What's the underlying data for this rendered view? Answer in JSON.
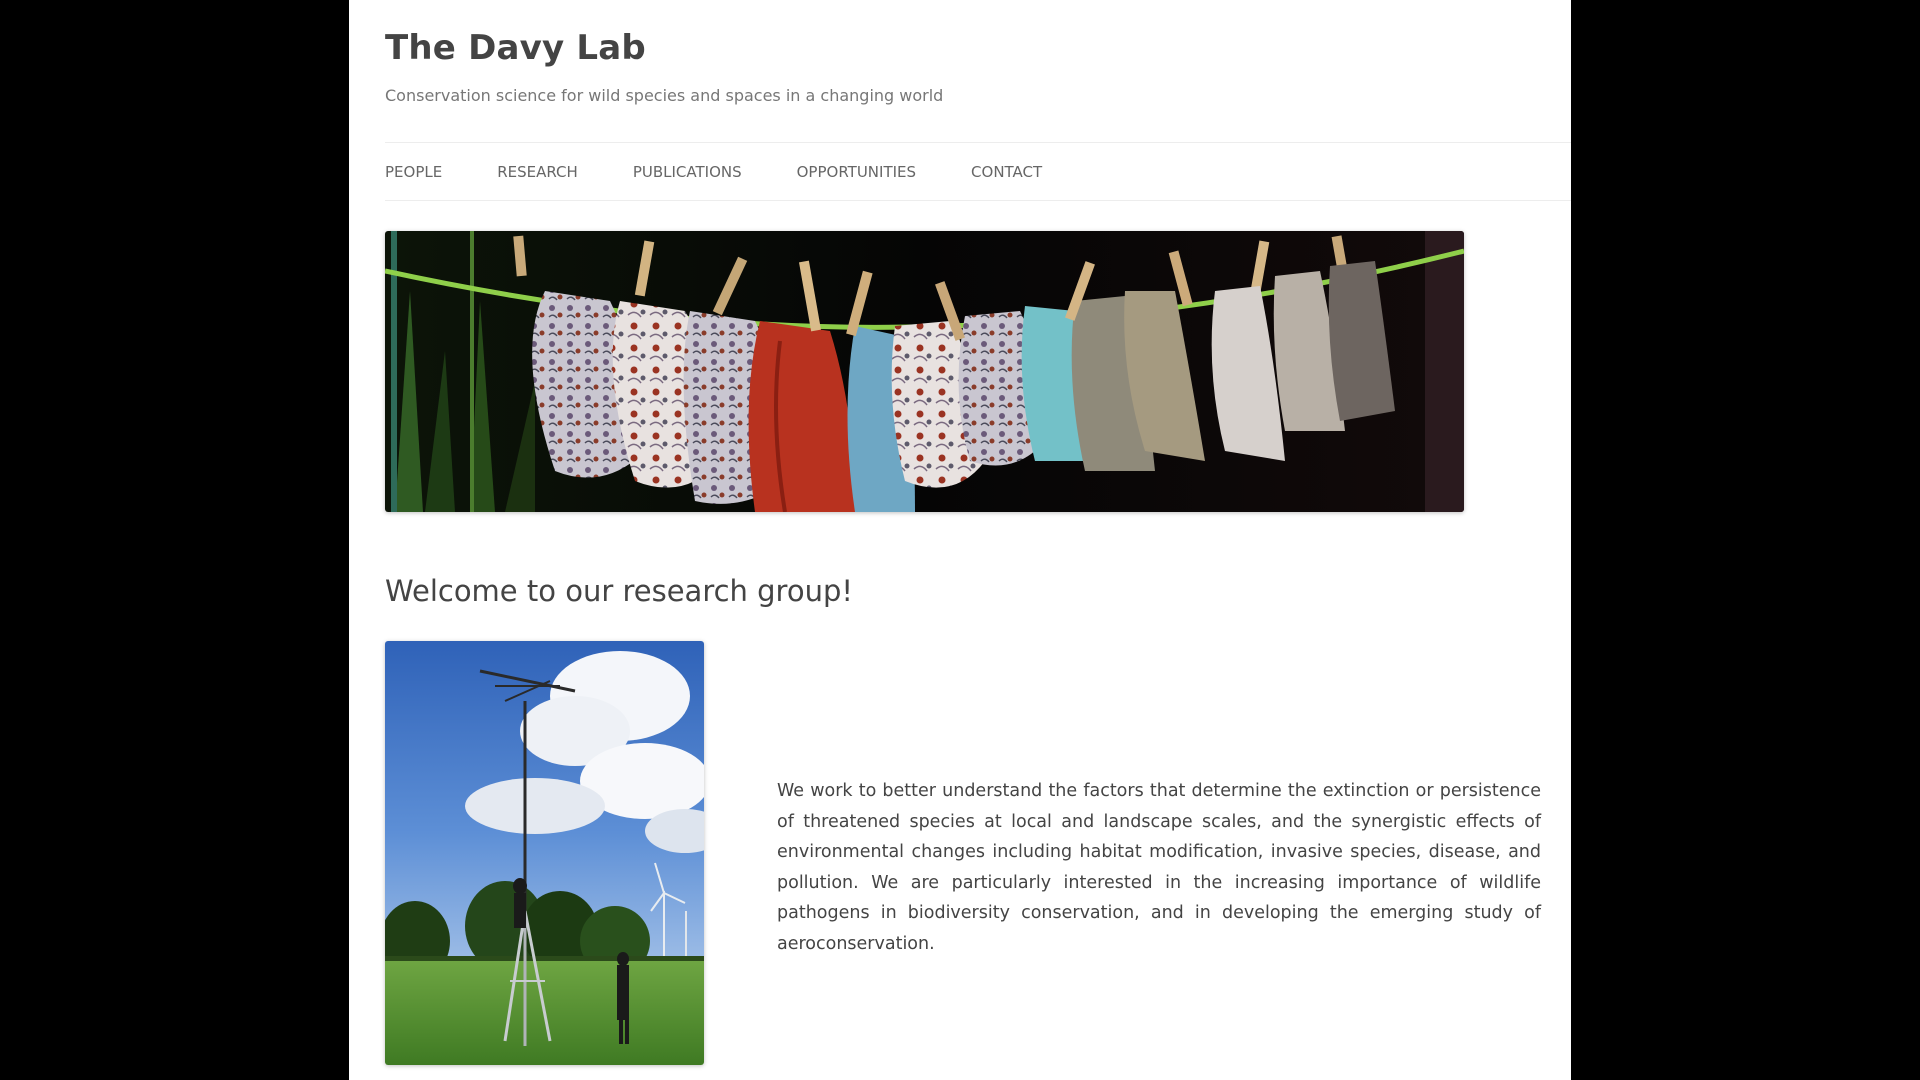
{
  "site": {
    "title": "The Davy Lab",
    "tagline": "Conservation science for wild species and spaces in a changing world"
  },
  "nav": {
    "items": [
      {
        "label": "PEOPLE"
      },
      {
        "label": "RESEARCH"
      },
      {
        "label": "PUBLICATIONS"
      },
      {
        "label": "OPPORTUNITIES"
      },
      {
        "label": "CONTACT"
      }
    ]
  },
  "main": {
    "heading": "Welcome to our research group!",
    "paragraph": "We work to better understand the factors that determine the extinction or persistence of threatened species at local and landscape scales, and the synergistic effects of environmental changes including habitat modification, invasive species, disease, and pollution. We are particularly interested in the increasing importance of wildlife pathogens in biodiversity conservation, and in developing the emerging study of aeroconservation."
  },
  "colors": {
    "outer_background": "#000000",
    "page_background": "#ffffff",
    "title_text": "#444444",
    "tagline_text": "#777777",
    "nav_text": "#666666",
    "nav_border": "#ededed"
  },
  "images": {
    "banner": "photo-of-cloth-bags-on-clothesline",
    "side_photo": "photo-of-person-on-antenna-tower-in-field"
  }
}
